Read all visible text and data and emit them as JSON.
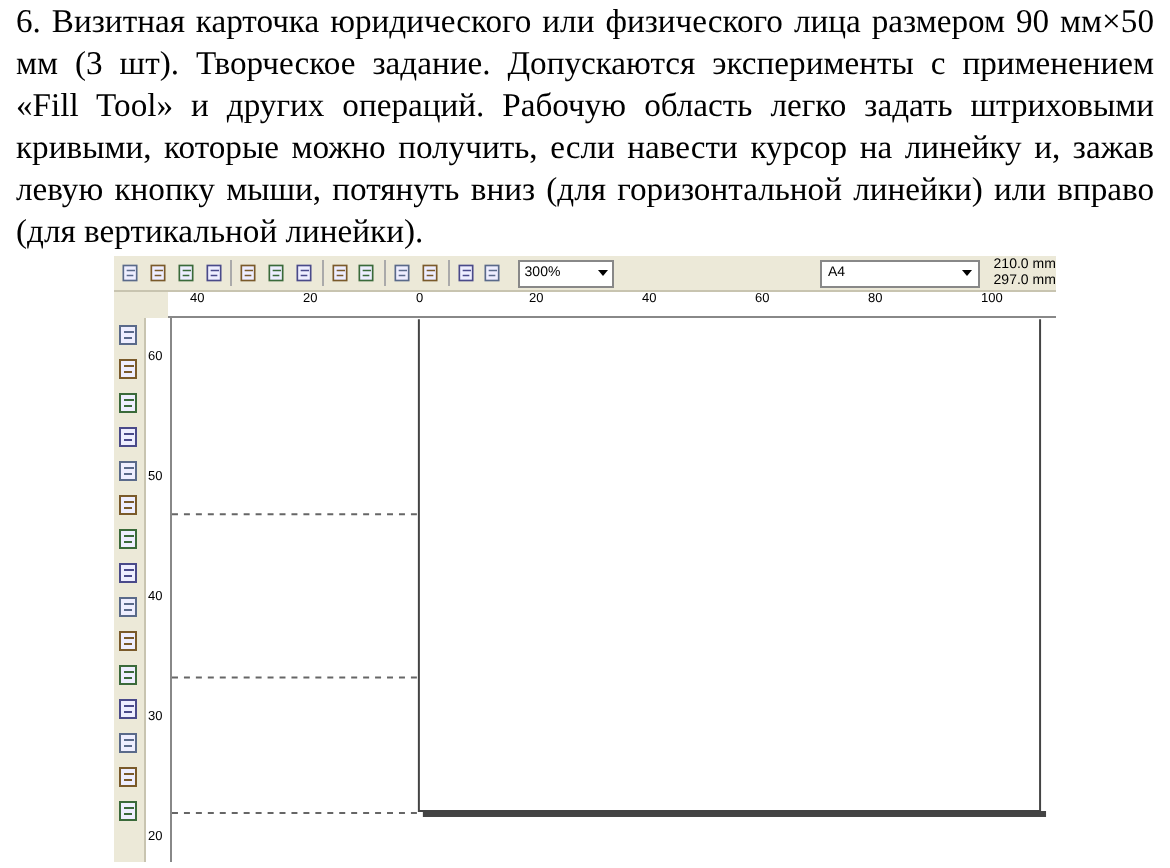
{
  "paragraph": "6. Визитная карточка юридического или физического лица размером 90 мм×50 мм (3 шт). Творческое задание. Допускаются эксперименты с применением «Fill Tool» и других операций. Рабочую область легко задать штриховыми кривыми, которые можно получить, если навести курсор на линейку и, зажав левую кнопку мыши, потянуть вниз (для горизонтальной линейки) или вправо (для вертикальной линейки).",
  "toolbar": {
    "zoom": "300%",
    "page_size": "A4",
    "page_width": "210.0 mm",
    "page_height": "297.0 mm"
  },
  "horizontal_ruler": [
    "40",
    "20",
    "0",
    "20",
    "40",
    "60",
    "80",
    "100"
  ],
  "vertical_ruler": [
    "60",
    "50",
    "40",
    "30",
    "20"
  ]
}
